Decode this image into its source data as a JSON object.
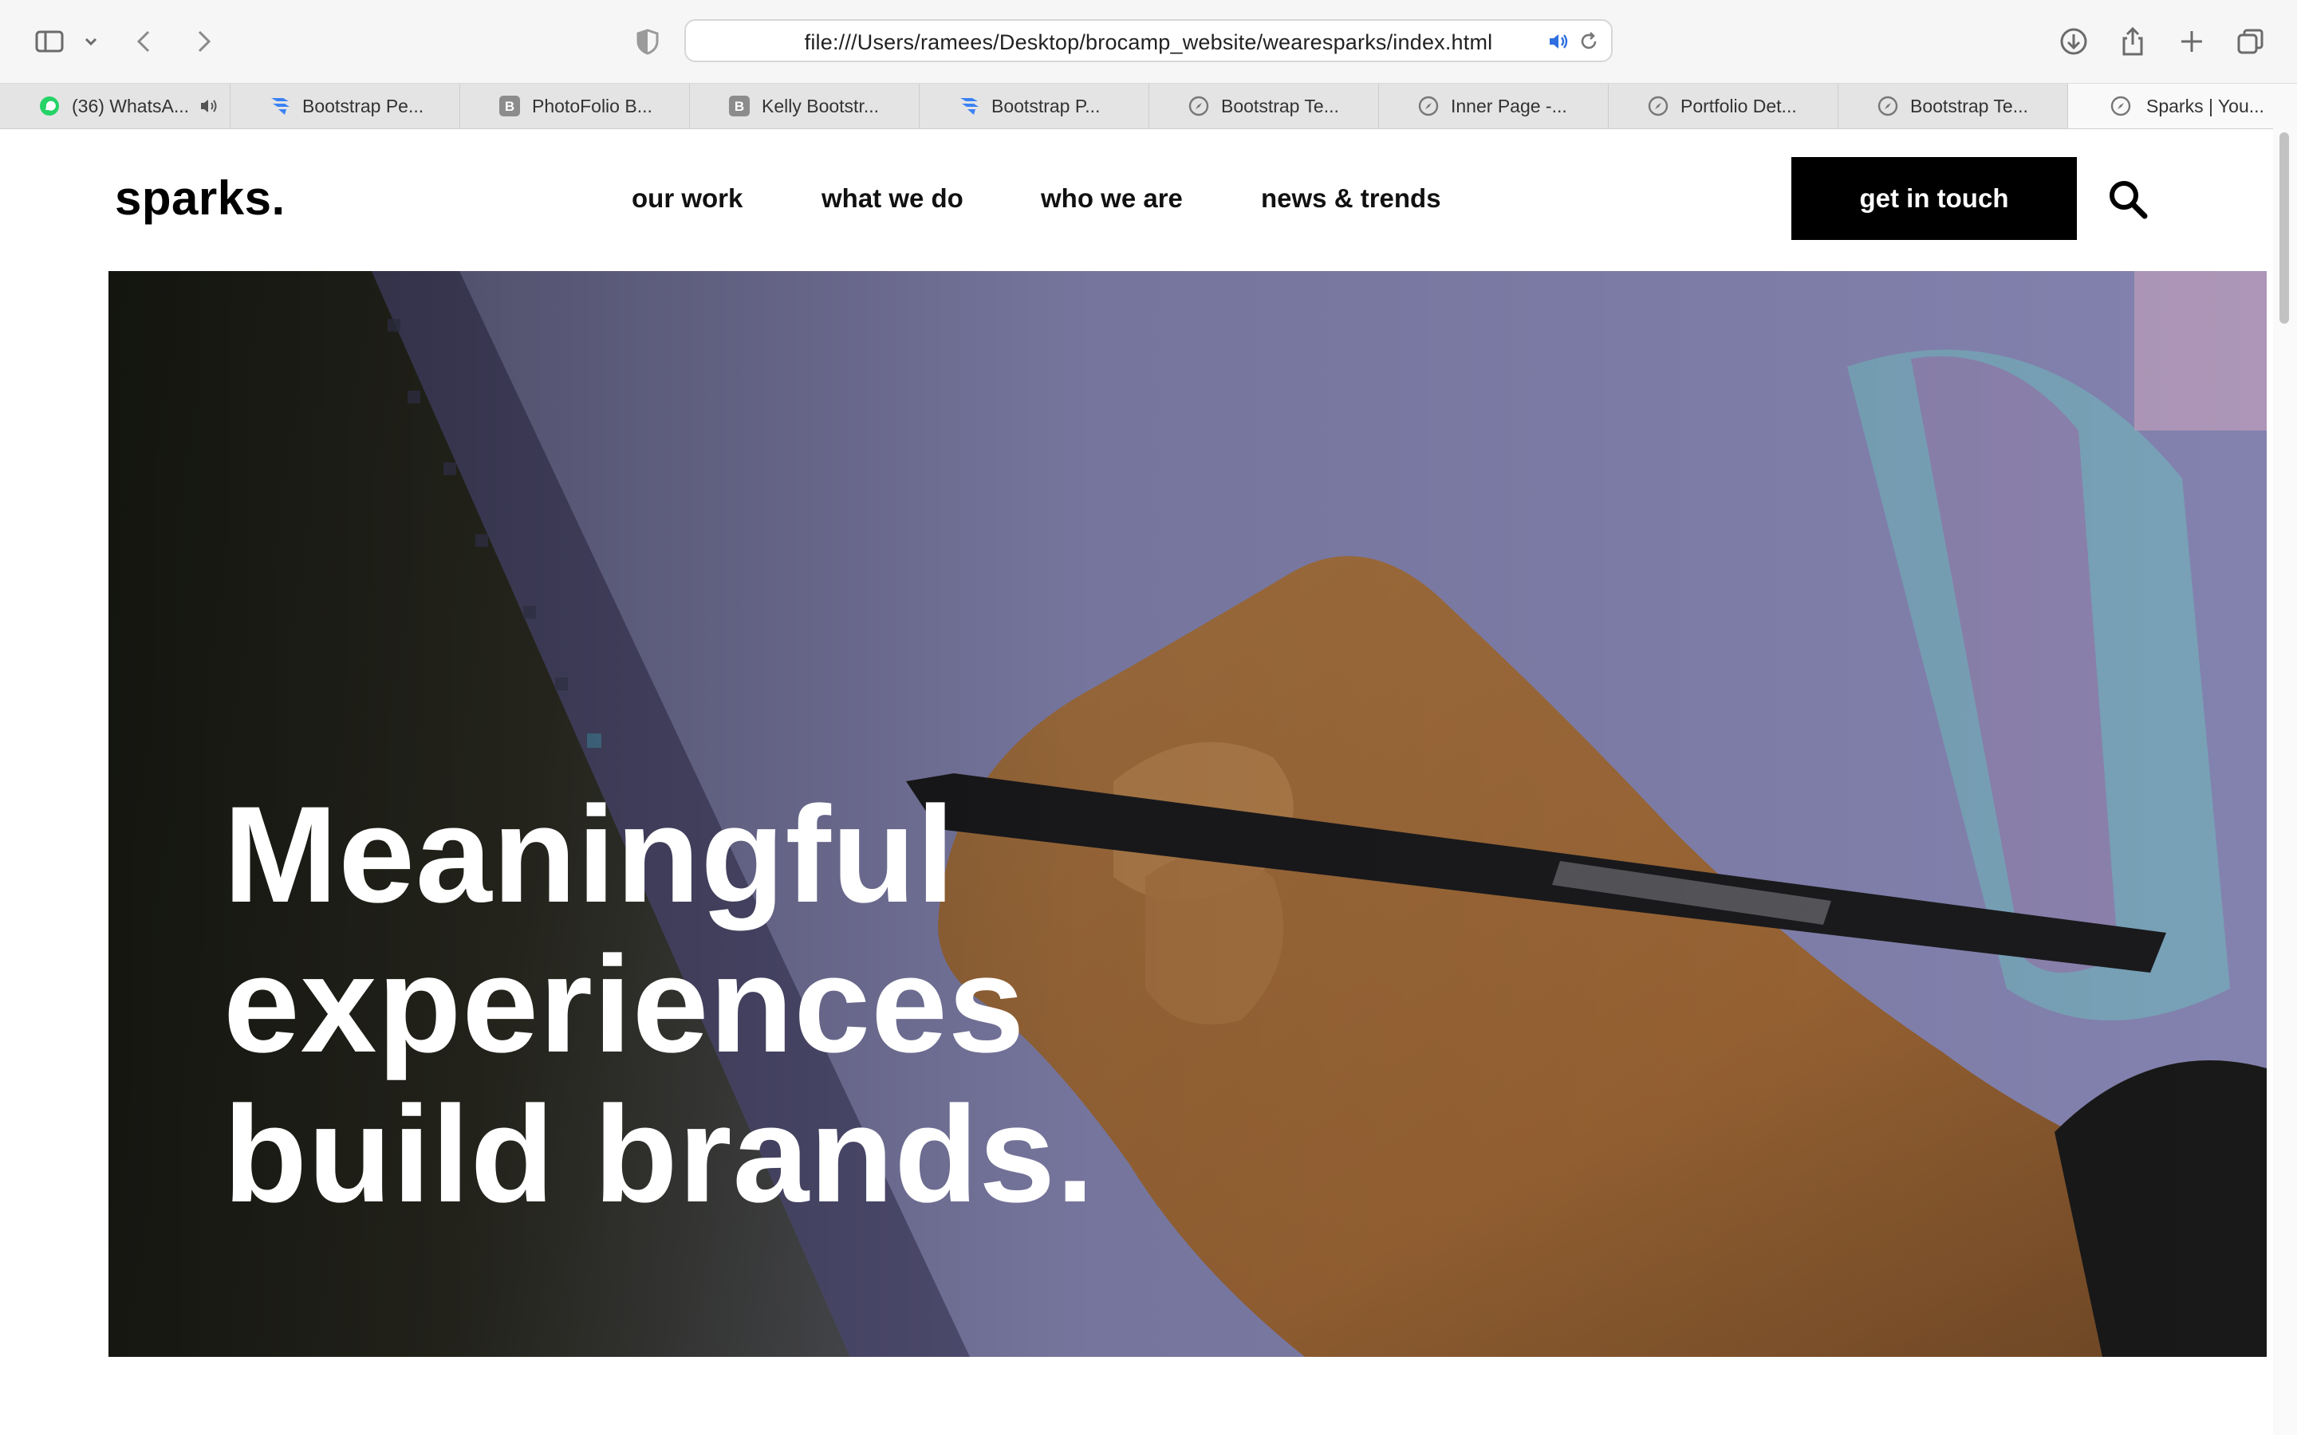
{
  "browser": {
    "url": "file:///Users/ramees/Desktop/brocamp_website/wearesparks/index.html",
    "tabs": [
      {
        "label": "(36) WhatsA...",
        "favicon": "whatsapp-icon"
      },
      {
        "label": "Bootstrap Pe...",
        "favicon": "bootstrap-blue-icon"
      },
      {
        "label": "PhotoFolio B...",
        "favicon": "b-square-icon"
      },
      {
        "label": "Kelly Bootstr...",
        "favicon": "b-square-icon"
      },
      {
        "label": "Bootstrap P...",
        "favicon": "bootstrap-blue-icon"
      },
      {
        "label": "Bootstrap Te...",
        "favicon": "compass-icon"
      },
      {
        "label": "Inner Page -...",
        "favicon": "compass-icon"
      },
      {
        "label": "Portfolio Det...",
        "favicon": "compass-icon"
      },
      {
        "label": "Bootstrap Te...",
        "favicon": "compass-icon"
      },
      {
        "label": "Sparks | You...",
        "favicon": "compass-icon"
      }
    ]
  },
  "site": {
    "logo": "sparks.",
    "nav": [
      "our work",
      "what we do",
      "who we are",
      "news & trends"
    ],
    "cta": "get in touch",
    "hero": {
      "line1": "Meaningful",
      "line2": "experiences",
      "line3": "build brands."
    }
  },
  "colors": {
    "accent_black": "#000000",
    "whatsapp_green": "#25d366",
    "bootstrap_blue": "#3b82f6"
  }
}
